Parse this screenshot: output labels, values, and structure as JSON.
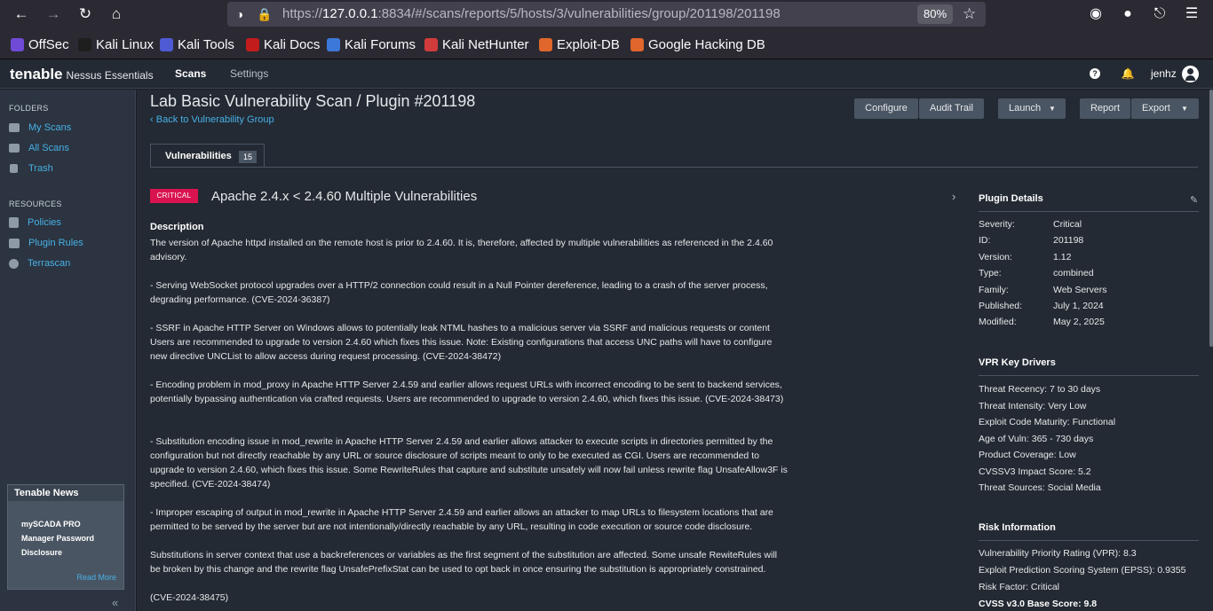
{
  "browser": {
    "url_prefix": "https://",
    "url_host": "127.0.0.1",
    "url_rest": ":8834/#/scans/reports/5/hosts/3/vulnerabilities/group/201198/201198",
    "zoom": "80%",
    "bookmarks": [
      {
        "label": "OffSec",
        "color": "#6f4ad6"
      },
      {
        "label": "Kali Linux",
        "color": "#1e1e1e"
      },
      {
        "label": "Kali Tools",
        "color": "#4f5bd5"
      },
      {
        "label": "Kali Docs",
        "color": "#c21c1c"
      },
      {
        "label": "Kali Forums",
        "color": "#3c78d8"
      },
      {
        "label": "Kali NetHunter",
        "color": "#d23b3b"
      },
      {
        "label": "Exploit-DB",
        "color": "#e0662b"
      },
      {
        "label": "Google Hacking DB",
        "color": "#e0662b"
      }
    ]
  },
  "header": {
    "logo": "tenable",
    "product": "Nessus Essentials",
    "nav": [
      "Scans",
      "Settings"
    ],
    "user": "jenhz"
  },
  "sidebar": {
    "folders_heading": "FOLDERS",
    "folders": [
      "My Scans",
      "All Scans",
      "Trash"
    ],
    "resources_heading": "RESOURCES",
    "resources": [
      "Policies",
      "Plugin Rules",
      "Terrascan"
    ],
    "news": {
      "title": "Tenable News",
      "body": "mySCADA PRO Manager Password Disclosure",
      "link": "Read More"
    },
    "collapse": "«"
  },
  "main": {
    "title": "Lab Basic Vulnerability Scan / Plugin #201198",
    "back": "Back to Vulnerability Group",
    "buttons": {
      "configure": "Configure",
      "audit": "Audit Trail",
      "launch": "Launch",
      "report": "Report",
      "export": "Export"
    },
    "tab": {
      "label": "Vulnerabilities",
      "count": "15"
    },
    "severity": "CRITICAL",
    "vuln_title": "Apache 2.4.x < 2.4.60 Multiple Vulnerabilities",
    "description_heading": "Description",
    "description": [
      "The version of Apache httpd installed on the remote host is prior to 2.4.60. It is, therefore, affected by multiple vulnerabilities as referenced in the 2.4.60 advisory.",
      "- Serving WebSocket protocol upgrades over a HTTP/2 connection could result in a Null Pointer dereference, leading to a crash of the server process, degrading performance. (CVE-2024-36387)",
      "- SSRF in Apache HTTP Server on Windows allows to potentially leak NTML hashes to a malicious server via SSRF and malicious requests or content Users are recommended to upgrade to version 2.4.60 which fixes this issue. Note: Existing configurations that access UNC paths will have to configure new directive UNCList to allow access during request processing. (CVE-2024-38472)",
      "- Encoding problem in mod_proxy in Apache HTTP Server 2.4.59 and earlier allows request URLs with incorrect encoding to be sent to backend services, potentially bypassing authentication via crafted requests. Users are recommended to upgrade to version 2.4.60, which fixes this issue. (CVE-2024-38473)",
      "- Substitution encoding issue in mod_rewrite in Apache HTTP Server 2.4.59 and earlier allows attacker to execute scripts in directories permitted by the configuration but not directly reachable by any URL or source disclosure of scripts meant to only to be executed as CGI. Users are recommended to upgrade to version 2.4.60, which fixes this issue. Some RewriteRules that capture and substitute unsafely will now fail unless rewrite flag UnsafeAllow3F is specified. (CVE-2024-38474)",
      "- Improper escaping of output in mod_rewrite in Apache HTTP Server 2.4.59 and earlier allows an attacker to map URLs to filesystem locations that are permitted to be served by the server but are not intentionally/directly reachable by any URL, resulting in code execution or source code disclosure.",
      "Substitutions in server context that use a backreferences or variables as the first segment of the substitution are affected. Some unsafe RewiteRules will be broken by this change and the rewrite flag UnsafePrefixStat can be used to opt back in once ensuring the substitution is appropriately constrained.",
      "(CVE-2024-38475)"
    ]
  },
  "plugin_details": {
    "heading": "Plugin Details",
    "rows": [
      {
        "k": "Severity:",
        "v": "Critical"
      },
      {
        "k": "ID:",
        "v": "201198"
      },
      {
        "k": "Version:",
        "v": "1.12"
      },
      {
        "k": "Type:",
        "v": "combined"
      },
      {
        "k": "Family:",
        "v": "Web Servers"
      },
      {
        "k": "Published:",
        "v": "July 1, 2024"
      },
      {
        "k": "Modified:",
        "v": "May 2, 2025"
      }
    ]
  },
  "vpr": {
    "heading": "VPR Key Drivers",
    "rows": [
      "Threat Recency: 7 to 30 days",
      "Threat Intensity: Very Low",
      "Exploit Code Maturity: Functional",
      "Age of Vuln: 365 - 730 days",
      "Product Coverage: Low",
      "CVSSV3 Impact Score: 5.2",
      "Threat Sources: Social Media"
    ]
  },
  "risk": {
    "heading": "Risk Information",
    "rows": [
      "Vulnerability Priority Rating (VPR): 8.3",
      "Exploit Prediction Scoring System (EPSS): 0.9355",
      "Risk Factor: Critical",
      "CVSS v3.0 Base Score: 9.8"
    ]
  }
}
